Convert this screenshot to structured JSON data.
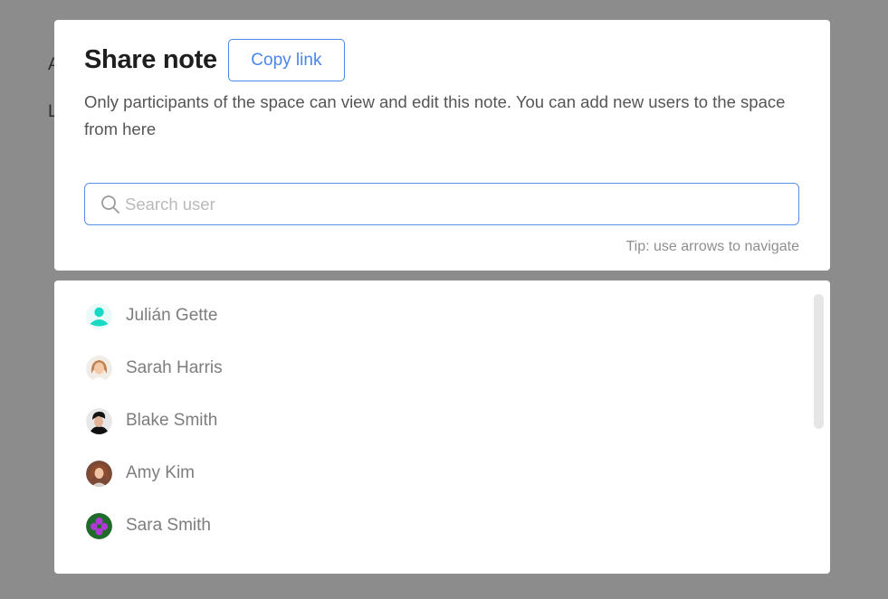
{
  "background": {
    "letters": [
      "A",
      "L"
    ]
  },
  "modal": {
    "title": "Share note",
    "copy_link_label": "Copy link",
    "description": "Only participants of the space can view and edit this note. You can add new users to the space from here",
    "search": {
      "placeholder": "Search user",
      "value": "",
      "icon": "search-icon"
    },
    "tip": "Tip: use arrows to navigate"
  },
  "users": [
    {
      "name": "Julián Gette",
      "avatar": "default-user-icon"
    },
    {
      "name": "Sarah Harris",
      "avatar": "photo"
    },
    {
      "name": "Blake Smith",
      "avatar": "photo"
    },
    {
      "name": "Amy Kim",
      "avatar": "photo"
    },
    {
      "name": "Sara Smith",
      "avatar": "pattern"
    }
  ],
  "colors": {
    "accent": "#4a86e8",
    "overlay": "#8c8c8c",
    "default_avatar": "#17d9c4"
  }
}
